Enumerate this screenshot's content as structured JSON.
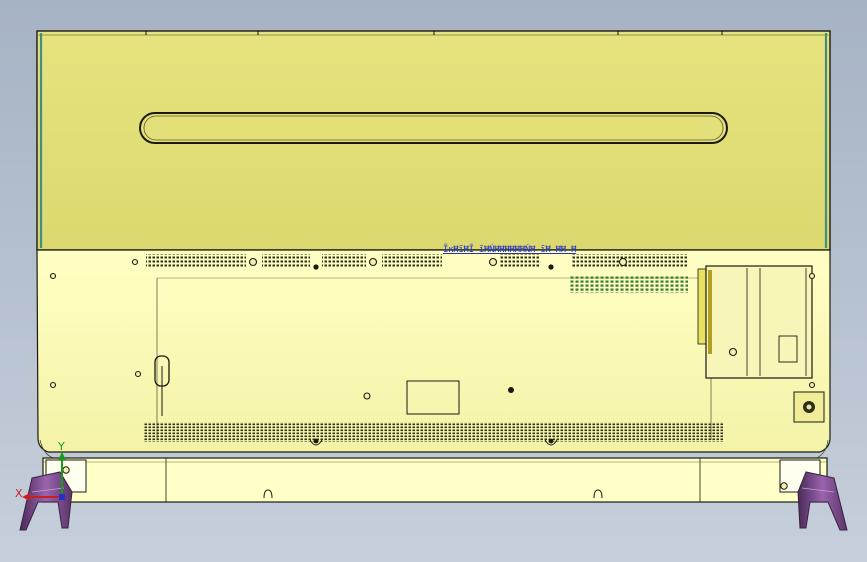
{
  "viewport": {
    "background_top": "#a6b3c4",
    "background_bottom": "#c6cfdb"
  },
  "model": {
    "colors": {
      "panel_top": "#e3e07a",
      "panel_bottom": "#ffffc2",
      "outline": "#1a1a10",
      "bezel_edge": "#3f8f86",
      "port_dark": "#3b4a1c",
      "port_green": "#4b8a3a",
      "stand": "#7a4b8c",
      "stand_dark": "#3a2244"
    },
    "annotation_text": "ĨĸĦĩĦĨ ĩĦŃĦĦĦĦĦĦŃĦ ĩĦ ĦĦ Ħ",
    "annotation_color": "#2333c8"
  },
  "triad": {
    "x_label": "X",
    "y_label": "Y",
    "x_color": "#c82020",
    "y_color": "#1a9a1a",
    "z_color": "#2030c8"
  }
}
